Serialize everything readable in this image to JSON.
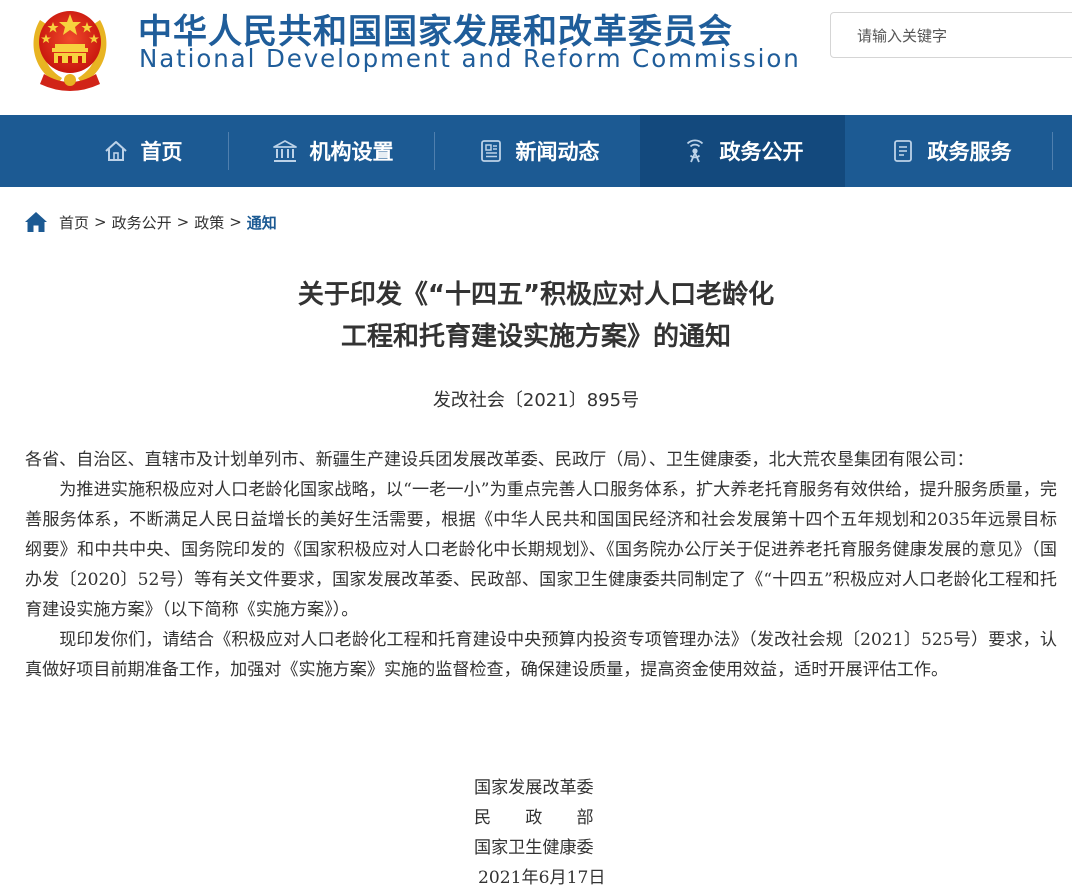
{
  "header": {
    "emblem_icon": "national-emblem",
    "title_cn": "中华人民共和国国家发展和改革委员会",
    "title_en": "National Development and Reform Commission",
    "search_placeholder": "请输入关键字",
    "brand_color": "#1f5d9a"
  },
  "nav": {
    "background": "#1c5a93",
    "active_background": "#13497d",
    "items": [
      {
        "label": "首页",
        "icon": "home-icon"
      },
      {
        "label": "机构设置",
        "icon": "institution-icon"
      },
      {
        "label": "新闻动态",
        "icon": "news-icon"
      },
      {
        "label": "政务公开",
        "icon": "broadcast-icon",
        "active": true
      },
      {
        "label": "政务服务",
        "icon": "document-icon"
      }
    ]
  },
  "breadcrumb": {
    "icon": "home-icon",
    "items": [
      "首页",
      "政务公开",
      "政策",
      "通知"
    ],
    "separator": ">"
  },
  "document": {
    "title_line1": "关于印发《“十四五”积极应对人口老龄化",
    "title_line2": "工程和托育建设实施方案》的通知",
    "number": "发改社会〔2021〕895号",
    "addressee": "各省、自治区、直辖市及计划单列市、新疆生产建设兵团发展改革委、民政厅（局）、卫生健康委，北大荒农垦集团有限公司：",
    "paragraph1": "为推进实施积极应对人口老龄化国家战略，以“一老一小”为重点完善人口服务体系，扩大养老托育服务有效供给，提升服务质量，完善服务体系，不断满足人民日益增长的美好生活需要，根据《中华人民共和国国民经济和社会发展第十四个五年规划和2035年远景目标纲要》和中共中央、国务院印发的《国家积极应对人口老龄化中长期规划》、《国务院办公厅关于促进养老托育服务健康发展的意见》（国办发〔2020〕52号）等有关文件要求，国家发展改革委、民政部、国家卫生健康委共同制定了《“十四五”积极应对人口老龄化工程和托育建设实施方案》（以下简称《实施方案》）。",
    "paragraph2": "现印发你们，请结合《积极应对人口老龄化工程和托育建设中央预算内投资专项管理办法》（发改社会规〔2021〕525号）要求，认真做好项目前期准备工作，加强对《实施方案》实施的监督检查，确保建设质量，提高资金使用效益，适时开展评估工作。",
    "signatories": [
      "国家发展改革委",
      "民　　政　　部",
      "国家卫生健康委"
    ],
    "date": "2021年6月17日"
  }
}
